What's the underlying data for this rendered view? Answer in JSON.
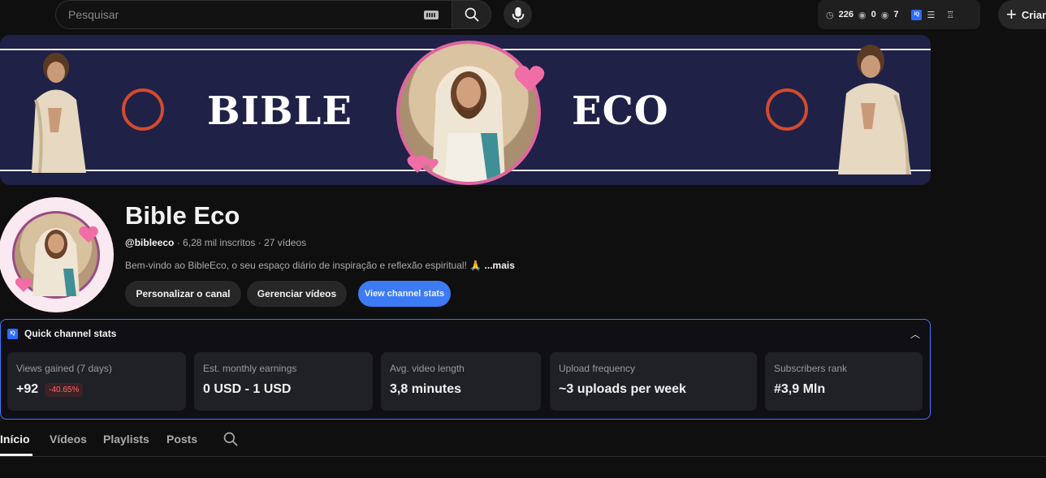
{
  "topbar": {
    "search_placeholder": "Pesquisar",
    "ext_clock_count": "226",
    "ext_eye_count": "0",
    "ext_views_count": "7",
    "ext_badge": "IQ",
    "create_label": "Criar"
  },
  "banner": {
    "word_left": "BIBLE",
    "word_right": "ECO"
  },
  "channel": {
    "name": "Bible Eco",
    "handle": "@bibleeco",
    "meta": " · 6,28 mil inscritos · 27 vídeos",
    "description": "Bem-vindo ao BibleEco, o seu espaço diário de inspiração e reflexão espiritual! 🙏 ",
    "more_label": "...mais",
    "buttons": {
      "customize": "Personalizar o canal",
      "manage": "Gerenciar vídeos",
      "stats": "View channel stats"
    }
  },
  "stats": {
    "title": "Quick channel stats",
    "badge": "IQ",
    "cards": [
      {
        "label": "Views gained (7 days)",
        "value": "+92",
        "delta": "-40.65%"
      },
      {
        "label": "Est. monthly earnings",
        "value": "0 USD - 1 USD"
      },
      {
        "label": "Avg. video length",
        "value": "3,8 minutes"
      },
      {
        "label": "Upload frequency",
        "value": "~3 uploads per week"
      },
      {
        "label": "Subscribers rank",
        "value": "#3,9 Mln"
      }
    ]
  },
  "tabs": [
    "Início",
    "Vídeos",
    "Playlists",
    "Posts"
  ],
  "colors": {
    "accent_blue": "#3d7bf5",
    "banner_bg": "#1f2147",
    "ring_red": "#d24a2e",
    "heart_pink": "#e0659f"
  }
}
